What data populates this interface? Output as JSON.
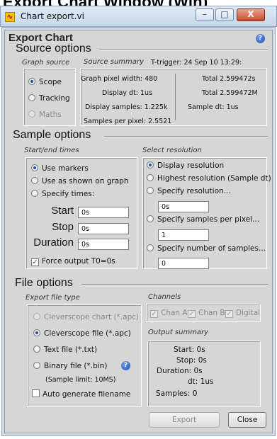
{
  "caption": "Export Chart Window (Win)",
  "window": {
    "title": "Chart export.vi",
    "minimize": "–",
    "maximize": "□",
    "close": "X"
  },
  "header": {
    "title": "Export Chart",
    "help_icon": "question-circle"
  },
  "source_options": {
    "heading": "Source options",
    "graph_source_label": "Graph source",
    "sources": [
      {
        "label": "Scope",
        "selected": true,
        "enabled": true
      },
      {
        "label": "Tracking",
        "selected": false,
        "enabled": true
      },
      {
        "label": "Maths",
        "selected": false,
        "enabled": false
      }
    ],
    "summary_label": "Source summary",
    "trigger": "T-trigger: 24 Sep 10 13:29:",
    "pixel_width": "Graph pixel width: 480",
    "display_dt": "Display dt: 1us",
    "display_samples": "Display samples: 1.225k",
    "samples_per_pixel": "Samples per pixel: 2.5521",
    "total_s": "Total 2.599472s",
    "total_m": "Total 2.599472M",
    "sample_dt": "Sample dt: 1us"
  },
  "sample_options": {
    "heading": "Sample options",
    "times_label": "Start/end times",
    "time_modes": [
      {
        "label": "Use markers",
        "selected": true
      },
      {
        "label": "Use as shown on graph",
        "selected": false
      },
      {
        "label": "Specify times:",
        "selected": false
      }
    ],
    "start_label": "Start",
    "start_value": "0s",
    "stop_label": "Stop",
    "stop_value": "0s",
    "duration_label": "Duration",
    "duration_value": "0s",
    "force_t0": "Force output T0=0s",
    "resolution_label": "Select resolution",
    "resolutions": [
      {
        "label": "Display resolution",
        "selected": true
      },
      {
        "label": "Highest resolution (Sample dt)",
        "selected": false
      },
      {
        "label": "Specify resolution...",
        "selected": false
      },
      {
        "label": "Specify samples per pixel...",
        "selected": false
      },
      {
        "label": "Specify number of samples...",
        "selected": false
      }
    ],
    "resolution_value": "0s",
    "spp_value": "1",
    "nsamples_value": "0"
  },
  "file_options": {
    "heading": "File options",
    "type_label": "Export file type",
    "types": [
      {
        "label": "Cleverscope chart (*.apc)",
        "selected": false,
        "enabled": false
      },
      {
        "label": "Cleverscope file (*.apc)",
        "selected": true,
        "enabled": true
      },
      {
        "label": "Text file (*.txt)",
        "selected": false,
        "enabled": true
      },
      {
        "label": "Binary file (*.bin)",
        "selected": false,
        "enabled": true
      }
    ],
    "sample_limit": "(Sample limit: 10MS)",
    "auto_filename": "Auto generate filename",
    "channels_label": "Channels",
    "channels": [
      "Chan A",
      "Chan B",
      "Digital"
    ],
    "output_label": "Output summary",
    "out_start": "Start: 0s",
    "out_stop": "Stop: 0s",
    "out_duration": "Duration: 0s",
    "out_dt": "dt: 1us",
    "out_samples": "Samples: 0"
  },
  "buttons": {
    "export": "Export",
    "close": "Close"
  }
}
